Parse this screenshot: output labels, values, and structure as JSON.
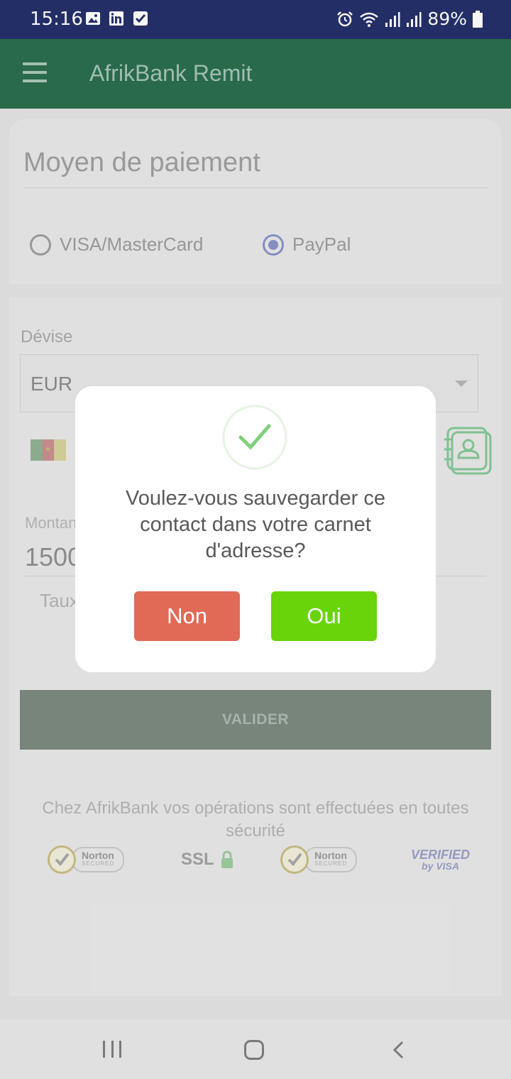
{
  "status_bar": {
    "time": "15:16",
    "battery": "89%"
  },
  "app_bar": {
    "title": "AfrikBank Remit"
  },
  "payment": {
    "heading": "Moyen de paiement",
    "options": [
      "VISA/MasterCard",
      "PayPal"
    ],
    "selected": "PayPal"
  },
  "form": {
    "devise_label": "Dévise",
    "devise_value": "EUR",
    "montant_label": "Montan",
    "montant_value": "1500",
    "taux_label": "Taux",
    "submit_label": "VALIDER"
  },
  "security": {
    "text": "Chez AfrikBank vos opérations sont effectuées en toutes sécurité",
    "badges": {
      "norton_name": "Norton",
      "norton_sub": "SECURED",
      "ssl": "SSL",
      "visa_line1": "VERIFIED",
      "visa_line2": "by VISA"
    }
  },
  "dialog": {
    "message": "Voulez-vous sauvegarder ce contact dans votre carnet d'adresse?",
    "no_label": "Non",
    "yes_label": "Oui",
    "colors": {
      "no": "#e06a56",
      "yes": "#69d40a",
      "check": "#7fd07a"
    }
  },
  "colors": {
    "status_bar": "#26306a",
    "app_bar": "#2b6e4d"
  }
}
